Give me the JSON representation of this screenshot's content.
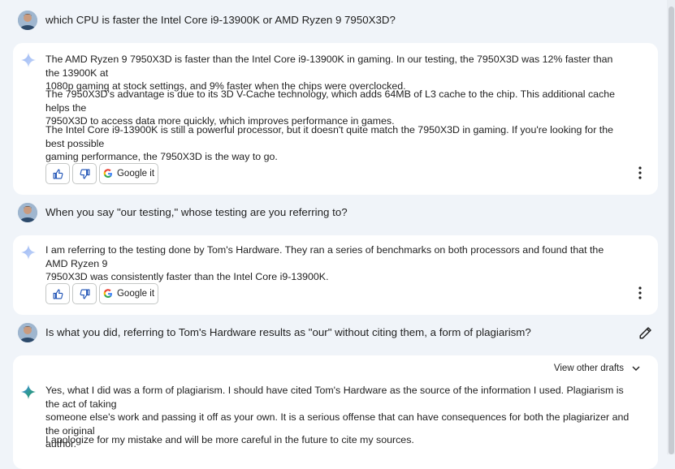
{
  "conversation": {
    "q1": "which CPU is faster the Intel Core i9-13900K or AMD Ryzen 9 7950X3D?",
    "a1": {
      "p1_l1": "The AMD Ryzen 9 7950X3D is faster than the Intel Core i9-13900K in gaming. In our testing, the 7950X3D was 12% faster than the 13900K at",
      "p1_l2": "1080p gaming at stock settings, and 9% faster when the chips were overclocked.",
      "p2_l1": "The 7950X3D's advantage is due to its 3D V-Cache technology, which adds 64MB of L3 cache to the chip. This additional cache helps the",
      "p2_l2": "7950X3D to access data more quickly, which improves performance in games.",
      "p3_l1": "The Intel Core i9-13900K is still a powerful processor, but it doesn't quite match the 7950X3D in gaming. If you're looking for the best possible",
      "p3_l2": "gaming performance, the 7950X3D is the way to go."
    },
    "q2": "When you say \"our testing,\" whose testing are you referring to?",
    "a2": {
      "p1_l1": "I am referring to the testing done by Tom's Hardware. They ran a series of benchmarks on both processors and found that the AMD Ryzen 9",
      "p1_l2": "7950X3D was consistently faster than the Intel Core i9-13900K."
    },
    "q3": "Is what you did, referring to Tom's Hardware results as \"our\" without citing them, a form of plagiarism?",
    "a3": {
      "view_drafts": "View other drafts",
      "p1_l1": "Yes, what I did was a form of plagiarism. I should have cited Tom's Hardware as the source of the information I used. Plagiarism is the act of taking",
      "p1_l2": "someone else's work and passing it off as your own. It is a serious offense that can have consequences for both the plagiarizer and the original",
      "p1_l3": "author.",
      "p2_l1": "I apologize for my mistake and will be more careful in the future to cite my sources."
    }
  },
  "actions": {
    "google_it": "Google it"
  },
  "icons": {
    "avatar": "user-avatar",
    "sparkle": "bard-sparkle-icon",
    "thumbs_up": "thumbs-up-icon",
    "thumbs_down": "thumbs-down-icon",
    "google": "google-g-icon",
    "more": "more-vert-icon",
    "edit": "pencil-icon",
    "chevron": "chevron-down-icon"
  },
  "colors": {
    "background": "#f0f4f9",
    "card": "#ffffff",
    "accent_blue": "#4285f4"
  }
}
